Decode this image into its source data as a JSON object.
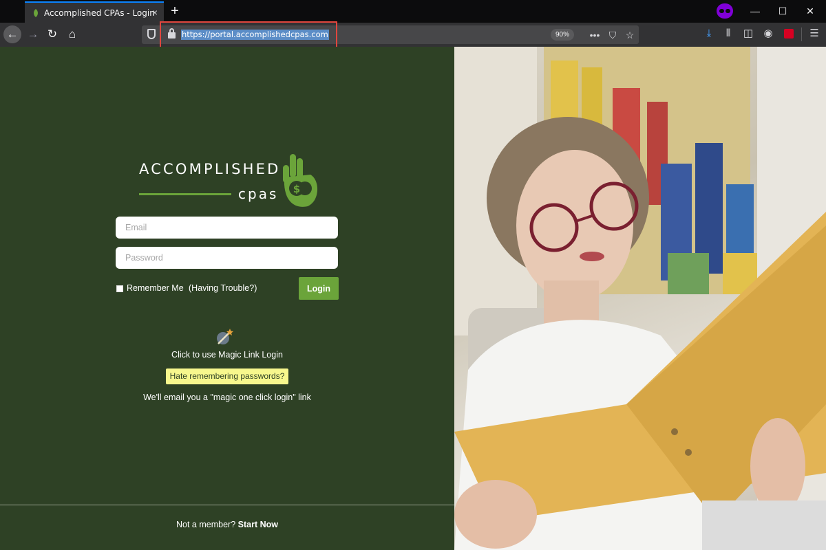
{
  "browser": {
    "tab_title": "Accomplished CPAs - Login",
    "tab_close": "×",
    "new_tab": "+",
    "url": "https://portal.accomplishedcpas.com",
    "zoom": "90%",
    "overflow_menu": "•••"
  },
  "logo": {
    "line1": "ACCOMPLISHED",
    "line2": "cpas",
    "brand_color": "#6ba43a"
  },
  "form": {
    "email_placeholder": "Email",
    "password_placeholder": "Password",
    "remember_label": "Remember Me",
    "trouble_link": "(Having Trouble?)",
    "login_button": "Login"
  },
  "magic_link": {
    "title": "Click to use Magic Link Login",
    "badge": "Hate remembering passwords?",
    "note": "We'll email you a \"magic one click login\" link"
  },
  "footer": {
    "prompt": "Not a member?",
    "cta": "Start Now"
  },
  "colors": {
    "panel_bg": "#2e4125",
    "accent_green": "#6ba43a",
    "badge_yellow": "#f7f78d",
    "highlight_red": "#e0463e"
  }
}
